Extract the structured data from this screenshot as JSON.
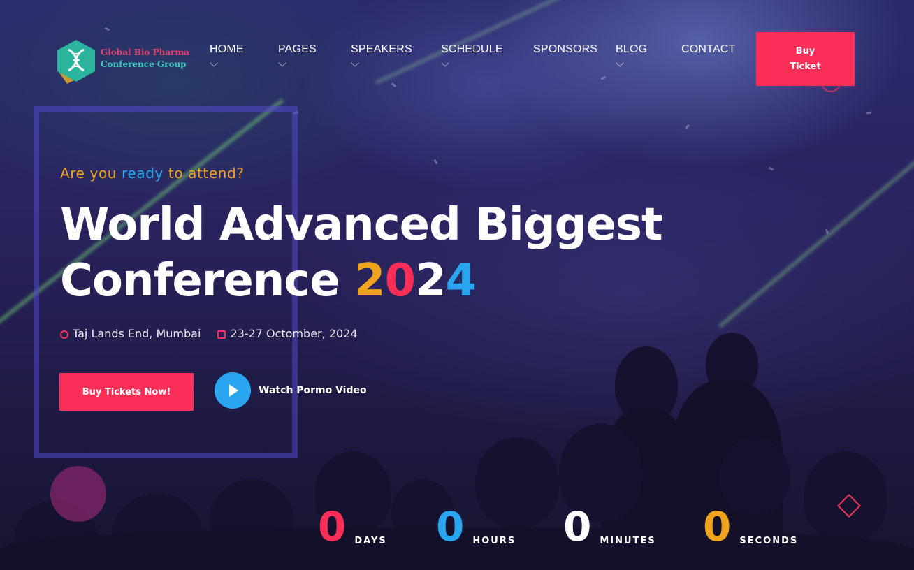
{
  "brand": {
    "logo_line1": "Global Bio Pharma",
    "logo_line2": "Conference Group"
  },
  "nav": {
    "items": [
      {
        "label": "HOME",
        "has_dropdown": true
      },
      {
        "label": "PAGES",
        "has_dropdown": true
      },
      {
        "label": "SPEAKERS",
        "has_dropdown": true
      },
      {
        "label": "SCHEDULE",
        "has_dropdown": true
      },
      {
        "label": "SPONSORS",
        "has_dropdown": false
      },
      {
        "label": "BLOG",
        "has_dropdown": true
      },
      {
        "label": "CONTACT",
        "has_dropdown": false
      }
    ],
    "cta_label": "Buy Ticket"
  },
  "hero": {
    "tagline_part1": "Are you ",
    "tagline_part2": "ready",
    "tagline_part3": " to attend?",
    "title_line1_a": "World Advanced ",
    "title_line1_b": "Biggest",
    "title_line2_a": "Conference ",
    "year_digits": [
      "2",
      "0",
      "2",
      "4"
    ],
    "location": "Taj Lands End, Mumbai",
    "date": "23-27 Octomber, 2024",
    "buy_button": "Buy Tickets Now!",
    "watch_label": "Watch Pormo Video"
  },
  "countdown": {
    "days": {
      "value": "0",
      "label": "DAYS"
    },
    "hours": {
      "value": "0",
      "label": "HOURS"
    },
    "minutes": {
      "value": "0",
      "label": "MINUTES"
    },
    "seconds": {
      "value": "0",
      "label": "SECONDS"
    }
  },
  "colors": {
    "accent_pink": "#fb2e57",
    "accent_blue": "#29a6ef",
    "accent_orange": "#f0a31c",
    "background": "#221d48"
  },
  "icons": [
    "dna-logo-icon",
    "clock-icon",
    "calendar-icon",
    "play-icon",
    "chevron-down-icon"
  ]
}
